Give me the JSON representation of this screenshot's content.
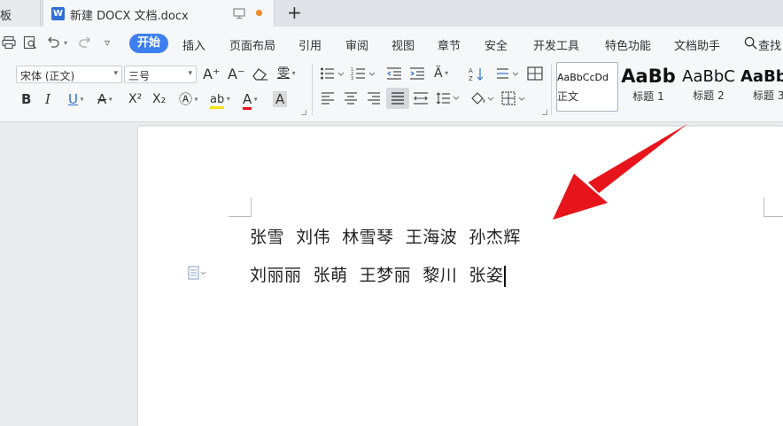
{
  "tabs": {
    "previous_label": "板",
    "active_icon_letter": "W",
    "active_title": "新建 DOCX 文档.docx",
    "new_tab_symbol": "+"
  },
  "menu": {
    "items": [
      "开始",
      "插入",
      "页面布局",
      "引用",
      "审阅",
      "视图",
      "章节",
      "安全",
      "开发工具",
      "特色功能",
      "文档助手"
    ],
    "search_label": "查找"
  },
  "ribbon": {
    "font_name": "宋体 (正文)",
    "font_size": "三号",
    "grow_font": "A⁺",
    "shrink_font": "A⁻",
    "phonetic": "雯",
    "bold": "B",
    "italic": "I",
    "underline": "U",
    "strike": "A",
    "superscript": "X²",
    "subscript": "X₂",
    "font_color": "A",
    "char_shading": "A",
    "highlight": "ab",
    "styles": [
      {
        "sample": "AaBbCcDd",
        "name": "正文"
      },
      {
        "sample": "AaBb",
        "name": "标题 1"
      },
      {
        "sample": "AaBbC",
        "name": "标题 2"
      },
      {
        "sample": "AaBb",
        "name": "标题 3"
      }
    ]
  },
  "document": {
    "line1": "张雪  刘伟  林雪琴  王海波  孙杰辉",
    "line2": "刘丽丽  张萌  王梦丽  黎川  张姿"
  },
  "colors": {
    "accent": "#3d7ff0",
    "arrow": "#e8141b",
    "unsaved_dot": "#f08a24"
  }
}
